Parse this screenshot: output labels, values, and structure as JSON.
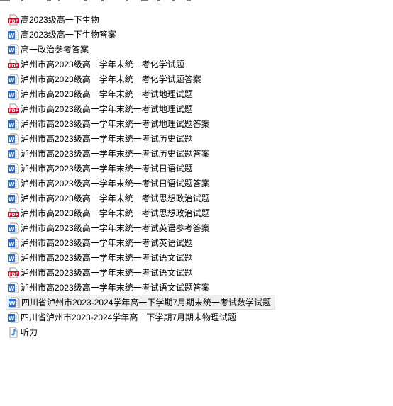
{
  "files": [
    {
      "name": "高2023级高一下生物",
      "type": "pdf"
    },
    {
      "name": "高2023级高一下生物答案",
      "type": "word"
    },
    {
      "name": "高一政治参考答案",
      "type": "word"
    },
    {
      "name": "泸州市高2023级高一学年末统一考化学试题",
      "type": "pdf"
    },
    {
      "name": "泸州市高2023级高一学年末统一考化学试题答案",
      "type": "word"
    },
    {
      "name": "泸州市高2023级高一学年末统一考试地理试题",
      "type": "word"
    },
    {
      "name": "泸州市高2023级高一学年末统一考试地理试题",
      "type": "pdf"
    },
    {
      "name": "泸州市高2023级高一学年末统一考试地理试题答案",
      "type": "word"
    },
    {
      "name": "泸州市高2023级高一学年末统一考试历史试题",
      "type": "word"
    },
    {
      "name": "泸州市高2023级高一学年末统一考试历史试题答案",
      "type": "word"
    },
    {
      "name": "泸州市高2023级高一学年末统一考试日语试题",
      "type": "word"
    },
    {
      "name": "泸州市高2023级高一学年末统一考试日语试题答案",
      "type": "word"
    },
    {
      "name": "泸州市高2023级高一学年末统一考试思想政治试题",
      "type": "word"
    },
    {
      "name": "泸州市高2023级高一学年末统一考试思想政治试题",
      "type": "pdf"
    },
    {
      "name": "泸州市高2023级高一学年末统一考试英语参考答案",
      "type": "word"
    },
    {
      "name": "泸州市高2023级高一学年末统一考试英语试题",
      "type": "word"
    },
    {
      "name": "泸州市高2023级高一学年末统一考试语文试题",
      "type": "word"
    },
    {
      "name": "泸州市高2023级高一学年末统一考试语文试题",
      "type": "pdf"
    },
    {
      "name": "泸州市高2023级高一学年末统一考试语文试题答案",
      "type": "word"
    },
    {
      "name": "四川省泸州市2023-2024学年高一下学期7月期末统一考试数学试题",
      "type": "word",
      "selected": true
    },
    {
      "name": "四川省泸州市2023-2024学年高一下学期7月期末物理试题",
      "type": "word"
    },
    {
      "name": "听力",
      "type": "audio"
    }
  ],
  "colors": {
    "pdf": "#c8102e",
    "word": "#2b6cc4",
    "audio": "#2a7fd4",
    "selection": "#f0f0f0"
  }
}
